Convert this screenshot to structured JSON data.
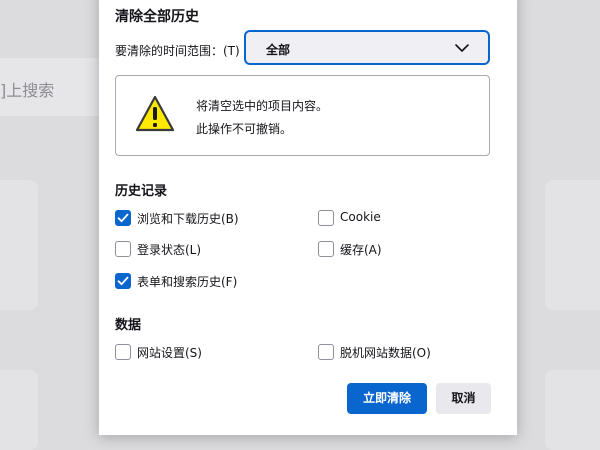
{
  "background": {
    "search_text": "]上搜索"
  },
  "dialog": {
    "title": "清除全部历史",
    "range_label": "要清除的时间范围：(T)",
    "range_value": "全部",
    "warning": {
      "line1": "将清空选中的项目内容。",
      "line2": "此操作不可撤销。"
    },
    "history_section": {
      "title": "历史记录",
      "items": [
        {
          "label": "浏览和下载历史(B)",
          "checked": true
        },
        {
          "label": "Cookie",
          "checked": false
        },
        {
          "label": "登录状态(L)",
          "checked": false
        },
        {
          "label": "缓存(A)",
          "checked": false
        },
        {
          "label": "表单和搜索历史(F)",
          "checked": true
        }
      ]
    },
    "data_section": {
      "title": "数据",
      "items": [
        {
          "label": "网站设置(S)",
          "checked": false
        },
        {
          "label": "脱机网站数据(O)",
          "checked": false
        }
      ]
    },
    "buttons": {
      "clear_now": "立即清除",
      "cancel": "取消"
    }
  },
  "colors": {
    "accent": "#0a66cf",
    "warning_yellow": "#ffe900"
  },
  "icons": [
    "warning-icon",
    "chevron-down-icon",
    "checkmark-icon"
  ]
}
